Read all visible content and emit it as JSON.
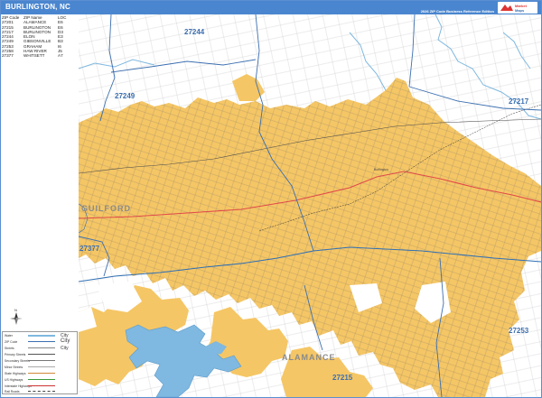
{
  "header": {
    "title": "BURLINGTON, NC",
    "edition": "2026 ZIP Code Business Reference Edition",
    "logo_text": "Market Maps"
  },
  "zip_table": {
    "headers": [
      "ZIP Code",
      "ZIP Name",
      "LOC"
    ],
    "rows": [
      [
        "27201",
        "ALAMANCE",
        "E6"
      ],
      [
        "27215",
        "BURLINGTON",
        "E6"
      ],
      [
        "27217",
        "BURLINGTON",
        "D3"
      ],
      [
        "27244",
        "ELON",
        "E3"
      ],
      [
        "27249",
        "GIBSONVILLE",
        "B3"
      ],
      [
        "27253",
        "GRAHAM",
        "I6"
      ],
      [
        "27258",
        "HAW RIVER",
        "J5"
      ],
      [
        "27377",
        "WHITSETT",
        "A7"
      ]
    ]
  },
  "map_labels": {
    "zips": [
      {
        "text": "27244"
      },
      {
        "text": "27249"
      },
      {
        "text": "27217"
      },
      {
        "text": "27377"
      },
      {
        "text": "27253"
      },
      {
        "text": "27215"
      }
    ],
    "places": [
      {
        "text": "GUILFORD"
      },
      {
        "text": "ALAMANCE"
      }
    ],
    "minor": [
      {
        "text": "Burlington"
      }
    ]
  },
  "legend": {
    "items": [
      {
        "label": "Water",
        "color": "#7fb8e0"
      },
      {
        "label": "ZIP Code",
        "color": "#3c6fb0"
      },
      {
        "label": "Streets",
        "color": "#888888"
      },
      {
        "label": "Primary Streets",
        "color": "#555555"
      },
      {
        "label": "Secondary Streets",
        "color": "#777777"
      },
      {
        "label": "Minor Streets",
        "color": "#aaaaaa"
      },
      {
        "label": "State Highways",
        "color": "#d28a3a"
      },
      {
        "label": "US Highways",
        "color": "#3a9a3a"
      },
      {
        "label": "Interstate Highways",
        "color": "#c33"
      },
      {
        "label": "Rail Roads",
        "color": "#444444"
      }
    ],
    "city_label_small": "City",
    "city_label_large": "City",
    "city_label_other": "City"
  },
  "colors": {
    "city_fill": "#f5c665",
    "water": "#7fb8e0",
    "zip_boundary": "#3c6fb0",
    "interstate": "#e04a4a",
    "road": "#2f6fb5"
  }
}
